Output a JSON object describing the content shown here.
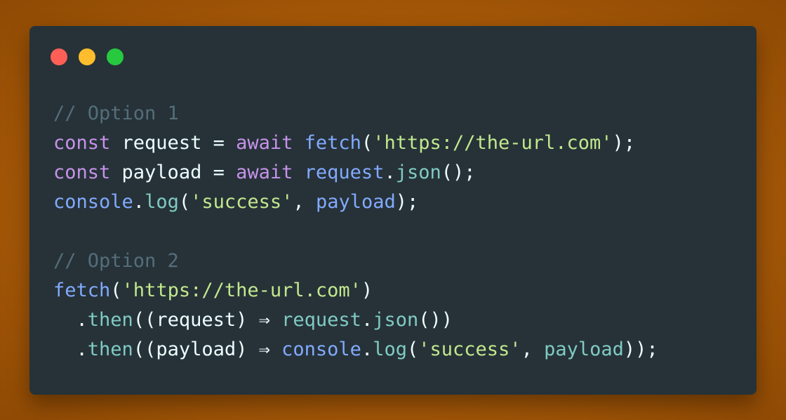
{
  "window": {
    "traffic_lights": [
      {
        "name": "close",
        "color": "#ff5f56"
      },
      {
        "name": "minimize",
        "color": "#ffbd2e"
      },
      {
        "name": "maximize",
        "color": "#27c93f"
      }
    ]
  },
  "colors": {
    "comment": "#546e7a",
    "keyword": "#c792ea",
    "function": "#82aaff",
    "string": "#c3e88d",
    "plain": "#eeffff",
    "method": "#80cbc4"
  },
  "code": {
    "lines": [
      [
        {
          "t": "// Option 1",
          "k": "comment"
        }
      ],
      [
        {
          "t": "const",
          "k": "keyword"
        },
        {
          "t": " request = ",
          "k": "plain"
        },
        {
          "t": "await",
          "k": "keyword"
        },
        {
          "t": " ",
          "k": "plain"
        },
        {
          "t": "fetch",
          "k": "function"
        },
        {
          "t": "(",
          "k": "plain"
        },
        {
          "t": "'https://the-url.com'",
          "k": "string"
        },
        {
          "t": ");",
          "k": "plain"
        }
      ],
      [
        {
          "t": "const",
          "k": "keyword"
        },
        {
          "t": " payload = ",
          "k": "plain"
        },
        {
          "t": "await",
          "k": "keyword"
        },
        {
          "t": " ",
          "k": "plain"
        },
        {
          "t": "request",
          "k": "function"
        },
        {
          "t": ".",
          "k": "plain"
        },
        {
          "t": "json",
          "k": "method"
        },
        {
          "t": "();",
          "k": "plain"
        }
      ],
      [
        {
          "t": "console",
          "k": "function"
        },
        {
          "t": ".",
          "k": "plain"
        },
        {
          "t": "log",
          "k": "method"
        },
        {
          "t": "(",
          "k": "plain"
        },
        {
          "t": "'success'",
          "k": "string"
        },
        {
          "t": ", ",
          "k": "plain"
        },
        {
          "t": "payload",
          "k": "function"
        },
        {
          "t": ");",
          "k": "plain"
        }
      ],
      [],
      [
        {
          "t": "// Option 2",
          "k": "comment"
        }
      ],
      [
        {
          "t": "fetch",
          "k": "function"
        },
        {
          "t": "(",
          "k": "plain"
        },
        {
          "t": "'https://the-url.com'",
          "k": "string"
        },
        {
          "t": ")",
          "k": "plain"
        }
      ],
      [
        {
          "t": "  .",
          "k": "plain"
        },
        {
          "t": "then",
          "k": "method"
        },
        {
          "t": "((request) ⇒ ",
          "k": "plain"
        },
        {
          "t": "request",
          "k": "method"
        },
        {
          "t": ".",
          "k": "plain"
        },
        {
          "t": "json",
          "k": "method"
        },
        {
          "t": "())",
          "k": "plain"
        }
      ],
      [
        {
          "t": "  .",
          "k": "plain"
        },
        {
          "t": "then",
          "k": "method"
        },
        {
          "t": "((payload) ⇒ ",
          "k": "plain"
        },
        {
          "t": "console",
          "k": "function"
        },
        {
          "t": ".",
          "k": "plain"
        },
        {
          "t": "log",
          "k": "method"
        },
        {
          "t": "(",
          "k": "plain"
        },
        {
          "t": "'success'",
          "k": "string"
        },
        {
          "t": ", ",
          "k": "plain"
        },
        {
          "t": "payload",
          "k": "method"
        },
        {
          "t": "));",
          "k": "plain"
        }
      ]
    ]
  }
}
